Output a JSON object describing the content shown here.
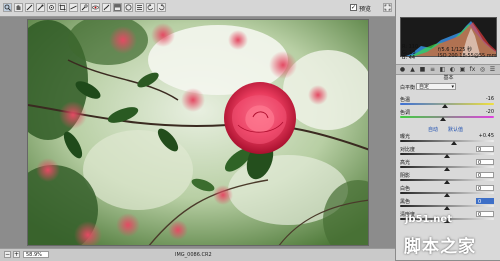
{
  "toolbar": {
    "tools": [
      "zoom-icon",
      "hand-icon",
      "white-balance-icon",
      "color-sampler-icon",
      "target-adjust-icon",
      "crop-icon",
      "straighten-icon",
      "spot-removal-icon",
      "red-eye-icon",
      "adjustment-brush-icon",
      "graduated-filter-icon",
      "radial-filter-icon",
      "preferences-icon",
      "rotate-ccw-icon",
      "rotate-cw-icon"
    ],
    "preview_label": "预览",
    "preview_checked": "✓"
  },
  "histogram": {
    "rgb_lines": [
      "R: 110",
      "G: 18",
      "B: 44"
    ],
    "exif_line1": "f/5.6  1/125 秒",
    "exif_line2": "ISO 200  18-55@55 mm"
  },
  "panel": {
    "tabs": [
      "●",
      "▲",
      "■",
      "≡",
      "◧",
      "◐",
      "▣",
      "fx",
      "◎",
      "☰"
    ],
    "title": "基本",
    "white_balance_label": "白平衡",
    "white_balance_value": "自定",
    "sliders_top": [
      {
        "label": "色温",
        "value": "-16"
      },
      {
        "label": "色调",
        "value": "-20"
      }
    ],
    "links": [
      "自动",
      "默认值"
    ],
    "sliders_bottom": [
      {
        "label": "曝光",
        "value": "+0.45"
      },
      {
        "label": "对比度",
        "value": "0"
      },
      {
        "label": "高光",
        "value": "0"
      },
      {
        "label": "阴影",
        "value": "0"
      },
      {
        "label": "白色",
        "value": "0"
      },
      {
        "label": "黑色",
        "value": "0"
      },
      {
        "label": "清晰度",
        "value": "0"
      }
    ]
  },
  "status": {
    "zoom_value": "58.9%",
    "file_name": "IMG_0086.CR2"
  },
  "watermark": {
    "domain": "jb51.net",
    "name": "脚本之家"
  },
  "colors": {
    "temp_track": "linear-gradient(90deg,#3c6fd6,#f0e040)",
    "tint_track": "linear-gradient(90deg,#3ecf3e,#e040e0)",
    "gray_track": "linear-gradient(90deg,#222,#eee)"
  }
}
